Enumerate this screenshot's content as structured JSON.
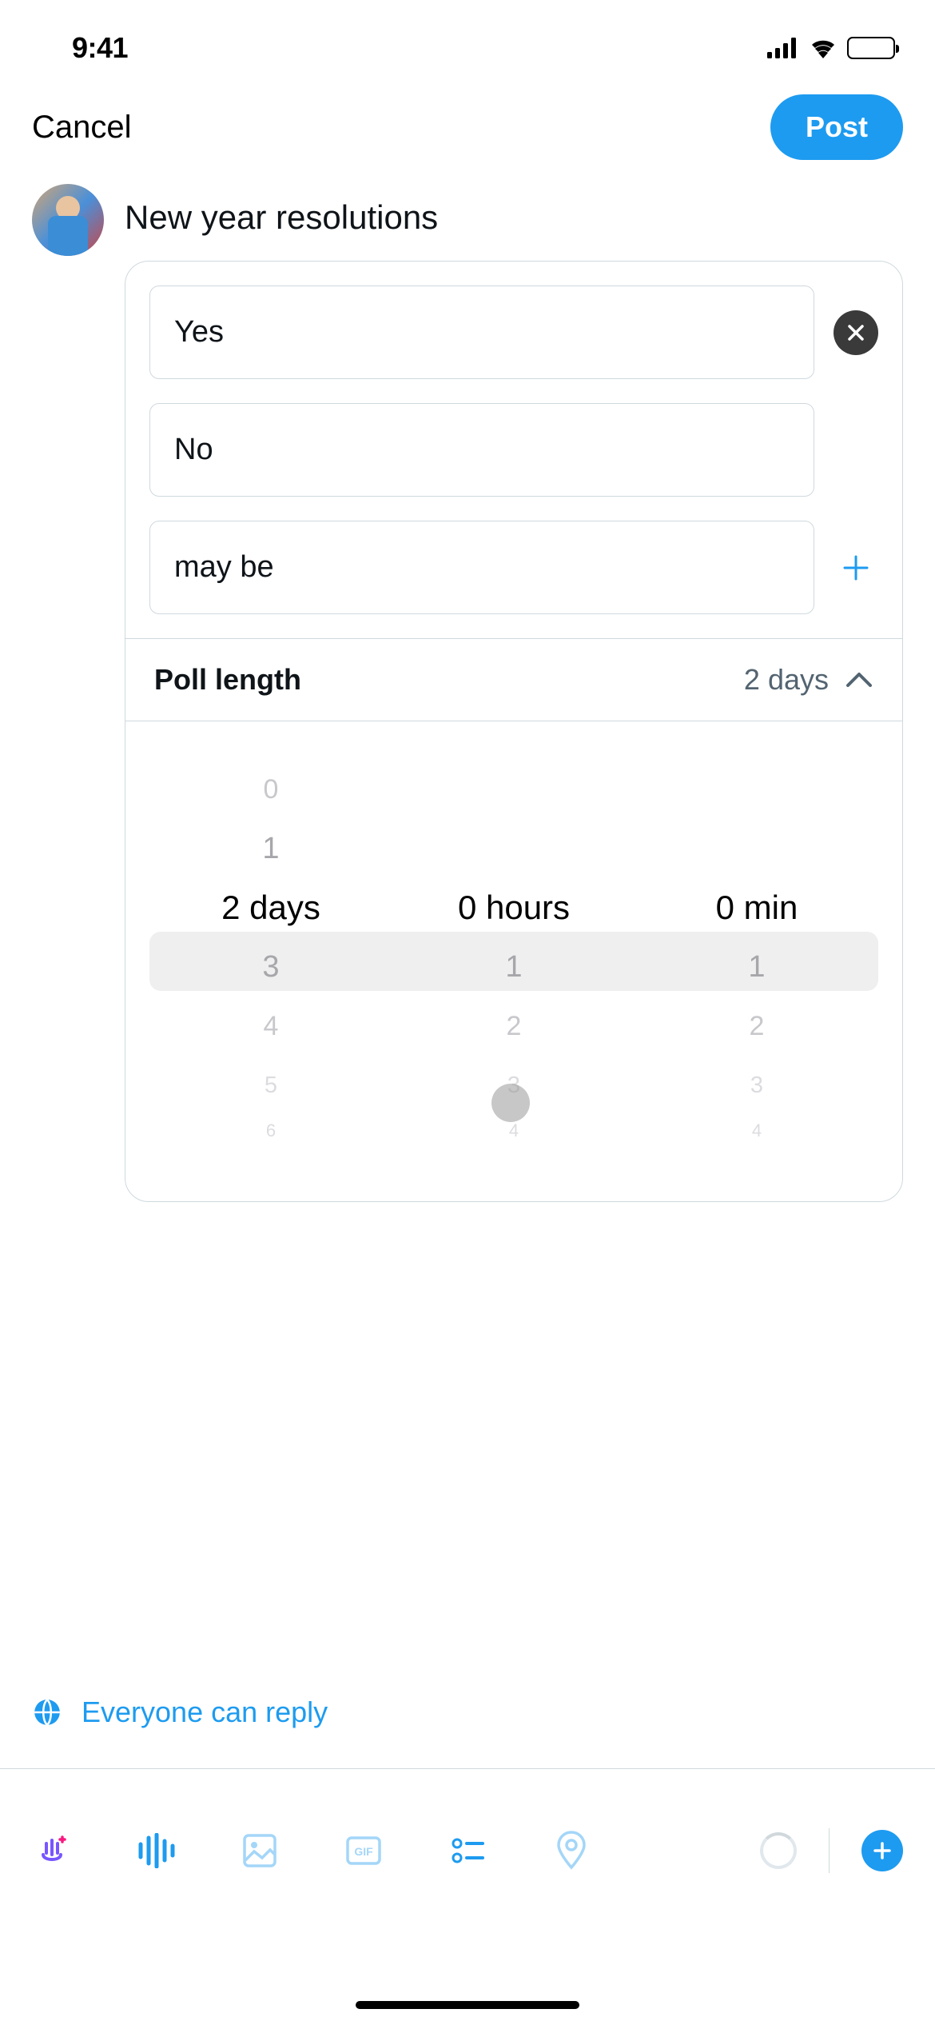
{
  "status": {
    "time": "9:41"
  },
  "header": {
    "cancel": "Cancel",
    "post": "Post"
  },
  "compose": {
    "text": "New year resolutions"
  },
  "poll": {
    "options": [
      "Yes",
      "No",
      "may be"
    ],
    "length_label": "Poll length",
    "length_value": "2 days",
    "picker": {
      "days": {
        "above2": "0",
        "above1": "1",
        "selected": "2 days",
        "below1": "3",
        "below2": "4",
        "below3": "5",
        "below4": "6"
      },
      "hours": {
        "selected": "0 hours",
        "below1": "1",
        "below2": "2",
        "below3": "3",
        "below4": "4"
      },
      "mins": {
        "selected": "0 min",
        "below1": "1",
        "below2": "2",
        "below3": "3",
        "below4": "4"
      }
    }
  },
  "reply": {
    "text": "Everyone can reply"
  },
  "icons": {
    "remove": "close-icon",
    "add": "plus-icon",
    "chevron": "chevron-up-icon"
  }
}
